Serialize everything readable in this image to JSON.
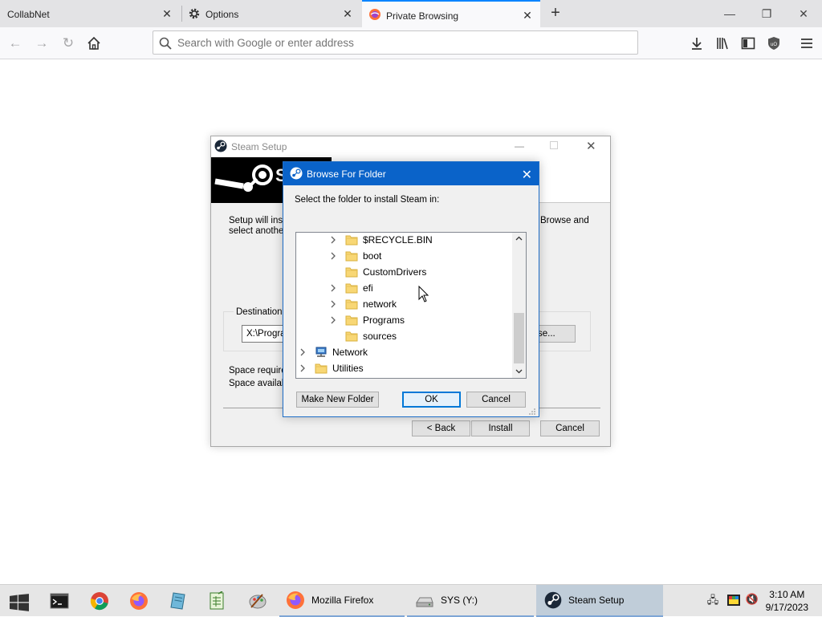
{
  "browser": {
    "tabs": [
      {
        "label": "CollabNet",
        "active": false
      },
      {
        "label": "Options",
        "active": false
      },
      {
        "label": "Private Browsing",
        "active": true
      }
    ],
    "search_placeholder": "Search with Google or enter address",
    "accent": "#0a84ff"
  },
  "setup": {
    "title": "Steam Setup",
    "banner_letter": "S",
    "desc_left_1": "Setup will insta",
    "desc_left_2": "select another",
    "desc_right": "Browse and",
    "group_label": "Destination",
    "dest_value": "X:\\Progra",
    "browse_label": "se...",
    "space_required": "Space require",
    "space_available": "Space availab",
    "back_label": "< Back",
    "install_label": "Install",
    "cancel_label": "Cancel"
  },
  "dialog": {
    "title": "Browse For Folder",
    "prompt": "Select the folder to install Steam in:",
    "tree": [
      {
        "label": "$RECYCLE.BIN",
        "expandable": true,
        "level": 1,
        "icon": "folder"
      },
      {
        "label": "boot",
        "expandable": true,
        "level": 1,
        "icon": "folder"
      },
      {
        "label": "CustomDrivers",
        "expandable": false,
        "level": 1,
        "icon": "folder"
      },
      {
        "label": "efi",
        "expandable": true,
        "level": 1,
        "icon": "folder"
      },
      {
        "label": "network",
        "expandable": true,
        "level": 1,
        "icon": "folder"
      },
      {
        "label": "Programs",
        "expandable": true,
        "level": 1,
        "icon": "folder"
      },
      {
        "label": "sources",
        "expandable": false,
        "level": 1,
        "icon": "folder"
      },
      {
        "label": "Network",
        "expandable": true,
        "level": 0,
        "icon": "network"
      },
      {
        "label": "Utilities",
        "expandable": true,
        "level": 0,
        "icon": "folder"
      }
    ],
    "make_folder_label": "Make New Folder",
    "ok_label": "OK",
    "cancel_label": "Cancel",
    "titlebar_color": "#0a63c9"
  },
  "taskbar": {
    "apps": [
      {
        "label": "Mozilla Firefox",
        "active": false
      },
      {
        "label": "SYS (Y:)",
        "active": false
      },
      {
        "label": "Steam Setup",
        "active": true
      }
    ],
    "time": "3:10 AM",
    "date": "9/17/2023"
  }
}
